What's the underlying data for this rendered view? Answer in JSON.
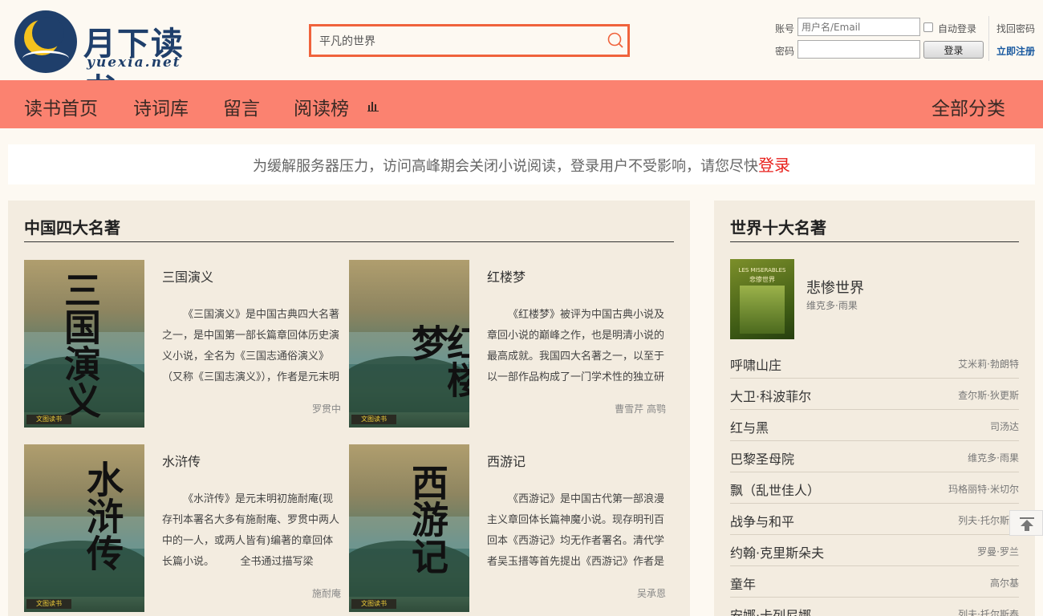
{
  "header": {
    "logo_cn": "月下读书",
    "logo_en": "yuexia.net",
    "search": {
      "value": "平凡的世界"
    },
    "login": {
      "account_label": "账号",
      "account_placeholder": "用户名/Email",
      "password_label": "密码",
      "auto_login_label": "自动登录",
      "login_button": "登录",
      "forgot_password": "找回密码",
      "register": "立即注册"
    }
  },
  "nav": {
    "items": [
      "读书首页",
      "诗词库",
      "留言",
      "阅读榜"
    ],
    "all_categories": "全部分类"
  },
  "notice": {
    "text": "为缓解服务器压力，访问高峰期会关闭小说阅读，登录用户不受影响，请您尽快",
    "login_link": "登录"
  },
  "main_section": {
    "title": "中国四大名著",
    "books": [
      {
        "name": "三国演义",
        "cover_text": "三国演义",
        "desc": "《三国演义》是中国古典四大名著之一，是中国第一部长篇章回体历史演义小说，全名为《三国志通俗演义》（又称《三国志演义》），作者是元末明",
        "author": "罗贯中"
      },
      {
        "name": "红楼梦",
        "cover_text": "红楼梦",
        "desc": "《红楼梦》被评为中国古典小说及章回小说的巅峰之作，也是明清小说的最高成就。我国四大名著之一，以至于以一部作品构成了一门学术性的独立研",
        "author": "曹雪芹 高鹗"
      },
      {
        "name": "水浒传",
        "cover_text": "水浒传",
        "desc": "《水浒传》是元末明初施耐庵(现存刊本署名大多有施耐庵、罗贯中两人中的一人，或两人皆有)编著的章回体长篇小说。　　　全书通过描写梁",
        "author": "施耐庵"
      },
      {
        "name": "西游记",
        "cover_text": "西游记",
        "desc": "《西游记》是中国古代第一部浪漫主义章回体长篇神魔小说。现存明刊百回本《西游记》均无作者署名。清代学者吴玉搢等首先提出《西游记》作者是",
        "author": "吴承恩"
      }
    ],
    "cover_stamp": "文图读书"
  },
  "side_section": {
    "title": "世界十大名著",
    "featured": {
      "title": "悲惨世界",
      "author": "维克多·雨果",
      "cover_title": "LES MISERABLES",
      "cover_cn": "悲惨世界"
    },
    "list": [
      {
        "title": "呼啸山庄",
        "author": "艾米莉·勃朗特"
      },
      {
        "title": "大卫·科波菲尔",
        "author": "查尔斯·狄更斯"
      },
      {
        "title": "红与黑",
        "author": "司汤达"
      },
      {
        "title": "巴黎圣母院",
        "author": "维克多·雨果"
      },
      {
        "title": "飘（乱世佳人）",
        "author": "玛格丽特·米切尔"
      },
      {
        "title": "战争与和平",
        "author": "列夫·托尔斯泰"
      },
      {
        "title": "约翰·克里斯朵夫",
        "author": "罗曼·罗兰"
      },
      {
        "title": "童年",
        "author": "高尔基"
      },
      {
        "title": "安娜·卡列尼娜",
        "author": "列夫·托尔斯泰"
      }
    ]
  },
  "colors": {
    "nav_bg": "#fb8270",
    "search_border": "#f0633c",
    "accent_red": "#e8201c",
    "link_blue": "#1a5aa0",
    "panel_bg": "#f3ece0"
  },
  "icons": {
    "search": "search-icon",
    "rank": "bar-chart-icon",
    "to_top": "arrow-up-to-top-icon"
  }
}
